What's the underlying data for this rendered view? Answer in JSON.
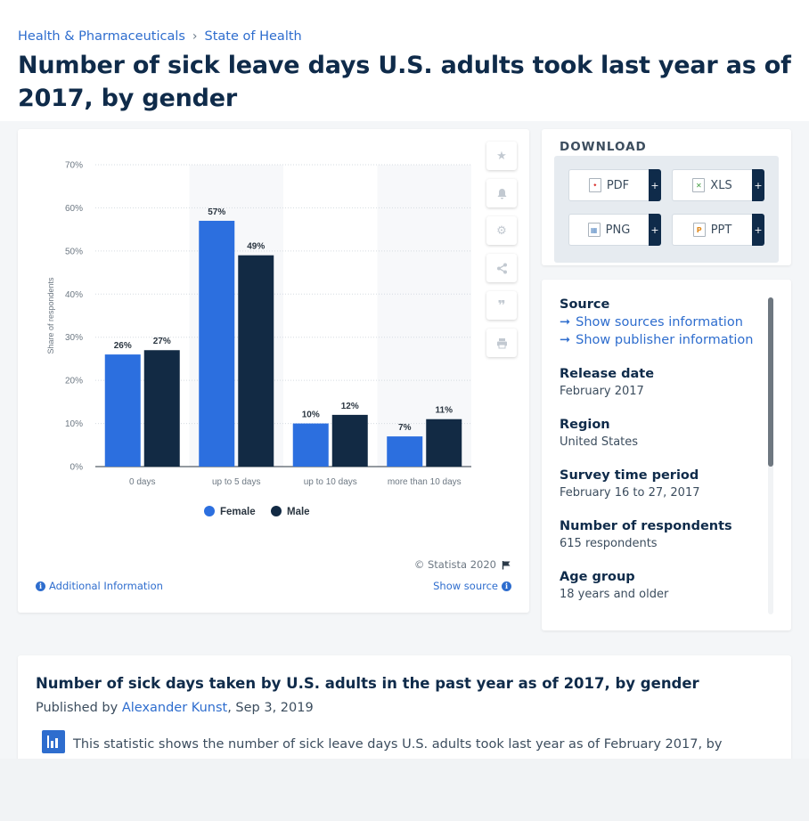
{
  "breadcrumb": {
    "items": [
      "Health & Pharmaceuticals",
      "State of Health"
    ],
    "separator": "›"
  },
  "page_title": "Number of sick leave days U.S. adults took last year as of 2017, by gender",
  "chart_data": {
    "type": "bar",
    "categories": [
      "0 days",
      "up to 5 days",
      "up to 10 days",
      "more than 10 days"
    ],
    "series": [
      {
        "name": "Female",
        "values": [
          26,
          57,
          10,
          7
        ],
        "labels": [
          "26%",
          "57%",
          "10%",
          "7%"
        ],
        "color": "#2c6fdf"
      },
      {
        "name": "Male",
        "values": [
          27,
          49,
          12,
          11
        ],
        "labels": [
          "27%",
          "49%",
          "12%",
          "11%"
        ],
        "color": "#122a44"
      }
    ],
    "ylabel": "Share of respondents",
    "xlabel": "",
    "ylim": [
      0,
      70
    ],
    "yticks": [
      0,
      10,
      20,
      30,
      40,
      50,
      60,
      70
    ],
    "ytick_labels": [
      "0%",
      "10%",
      "20%",
      "30%",
      "40%",
      "50%",
      "60%",
      "70%"
    ],
    "legend_position": "bottom",
    "grid": true
  },
  "chart_footer": {
    "copyright": "© Statista 2020",
    "additional_info": "Additional Information",
    "show_source": "Show source"
  },
  "toolbar": {
    "icons": [
      "star-icon",
      "bell-icon",
      "gear-icon",
      "share-icon",
      "quote-icon",
      "print-icon"
    ]
  },
  "download": {
    "heading": "DOWNLOAD",
    "buttons": [
      {
        "label": "PDF",
        "icon": "pdf-file-icon",
        "color": "#d9322f"
      },
      {
        "label": "XLS",
        "icon": "xls-file-icon",
        "color": "#3e9a3e"
      },
      {
        "label": "PNG",
        "icon": "png-file-icon",
        "color": "#5a8bc4"
      },
      {
        "label": "PPT",
        "icon": "ppt-file-icon",
        "color": "#e08a1e"
      }
    ],
    "plus": "+"
  },
  "info": {
    "source_label": "Source",
    "show_sources": "Show sources information",
    "show_publisher": "Show publisher information",
    "release_date_label": "Release date",
    "release_date": "February 2017",
    "region_label": "Region",
    "region": "United States",
    "survey_period_label": "Survey time period",
    "survey_period": "February 16 to 27, 2017",
    "respondents_label": "Number of respondents",
    "respondents": "615 respondents",
    "age_group_label": "Age group",
    "age_group": "18 years and older"
  },
  "description": {
    "title": "Number of sick days taken by U.S. adults in the past year as of 2017, by gender",
    "published_prefix": "Published by",
    "author": "Alexander Kunst",
    "date": ", Sep 3, 2019",
    "text": "This statistic shows the number of sick leave days U.S. adults took last year as of February 2017, by"
  }
}
